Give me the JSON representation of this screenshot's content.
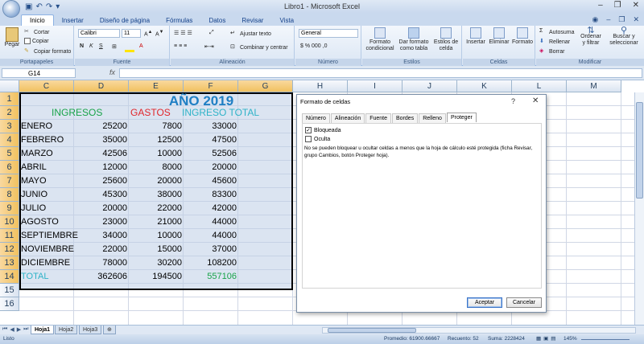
{
  "app": {
    "title": "Libro1 - Microsoft Excel"
  },
  "tabs": [
    {
      "label": "Inicio",
      "active": true
    },
    {
      "label": "Insertar"
    },
    {
      "label": "Diseño de página"
    },
    {
      "label": "Fórmulas"
    },
    {
      "label": "Datos"
    },
    {
      "label": "Revisar"
    },
    {
      "label": "Vista"
    }
  ],
  "ribbon": {
    "groups": {
      "portapapeles": "Portapapeles",
      "fuente": "Fuente",
      "alineacion": "Alineación",
      "numero": "Número",
      "estilos": "Estilos",
      "celdas": "Celdas",
      "modificar": "Modificar"
    },
    "pegar": "Pegar",
    "cortar": "Cortar",
    "copiar": "Copiar",
    "copiar_formato": "Copiar formato",
    "font_name": "Calibri",
    "font_size": "11",
    "ajustar_texto": "Ajustar texto",
    "combinar": "Combinar y centrar",
    "number_format": "General",
    "formato_condicional": "Formato\ncondicional",
    "dar_formato_tabla": "Dar formato\ncomo tabla",
    "estilos_celda": "Estilos de\ncelda",
    "insertar": "Insertar",
    "eliminar": "Eliminar",
    "formato": "Formato",
    "autosuma": "Autosuma",
    "rellenar": "Rellenar",
    "borrar": "Borrar",
    "ordenar": "Ordenar\ny filtrar",
    "buscar": "Buscar y\nseleccionar"
  },
  "formula_bar": {
    "name_box": "G14",
    "fx": "fx",
    "formula": ""
  },
  "columns": [
    "C",
    "D",
    "E",
    "F",
    "G",
    "H",
    "I",
    "J",
    "K",
    "L",
    "M"
  ],
  "rows": [
    "1",
    "2",
    "3",
    "4",
    "5",
    "6",
    "7",
    "8",
    "9",
    "10",
    "11",
    "12",
    "13",
    "14",
    "15",
    "16"
  ],
  "sheet": {
    "title": "AÑO 2019",
    "headers": {
      "ingresos": "INGRESOS",
      "gastos": "GASTOS",
      "total": "INGRESO TOTAL"
    },
    "data": [
      {
        "month": "ENERO",
        "ingresos": "25200",
        "gastos": "7800",
        "total": "33000"
      },
      {
        "month": "FEBRERO",
        "ingresos": "35000",
        "gastos": "12500",
        "total": "47500"
      },
      {
        "month": "MARZO",
        "ingresos": "42506",
        "gastos": "10000",
        "total": "52506"
      },
      {
        "month": "ABRIL",
        "ingresos": "12000",
        "gastos": "8000",
        "total": "20000"
      },
      {
        "month": "MAYO",
        "ingresos": "25600",
        "gastos": "20000",
        "total": "45600"
      },
      {
        "month": "JUNIO",
        "ingresos": "45300",
        "gastos": "38000",
        "total": "83300"
      },
      {
        "month": "JULIO",
        "ingresos": "20000",
        "gastos": "22000",
        "total": "42000"
      },
      {
        "month": "AGOSTO",
        "ingresos": "23000",
        "gastos": "21000",
        "total": "44000"
      },
      {
        "month": "SEPTIEMBRE",
        "ingresos": "34000",
        "gastos": "10000",
        "total": "44000"
      },
      {
        "month": "NOVIEMBRE",
        "ingresos": "22000",
        "gastos": "15000",
        "total": "37000"
      },
      {
        "month": "DICIEMBRE",
        "ingresos": "78000",
        "gastos": "30200",
        "total": "108200"
      }
    ],
    "total_row": {
      "label": "TOTAL",
      "ingresos": "362606",
      "gastos": "194500",
      "total": "557106"
    }
  },
  "dialog": {
    "title": "Formato de celdas",
    "help": "?",
    "close": "✕",
    "tabs": [
      "Número",
      "Alineación",
      "Fuente",
      "Bordes",
      "Relleno",
      "Proteger"
    ],
    "bloqueada": "Bloqueada",
    "bloqueada_checked": true,
    "oculta": "Oculta",
    "oculta_checked": false,
    "note": "No se pueden bloquear u ocultar celdas a menos que la hoja de cálculo esté protegida (ficha Revisar, grupo Cambios, botón Proteger hoja).",
    "accept": "Aceptar",
    "cancel": "Cancelar"
  },
  "sheet_tabs": [
    "Hoja1",
    "Hoja2",
    "Hoja3"
  ],
  "status": {
    "ready": "Listo",
    "promedio": "Promedio: 61900.66667",
    "recuento": "Recuento: 52",
    "suma": "Suma: 2228424",
    "zoom": "145%"
  },
  "colors": {
    "title_blue": "#1f7fc4",
    "green": "#19a349",
    "red": "#e0262b",
    "teal": "#2fb3c8"
  }
}
